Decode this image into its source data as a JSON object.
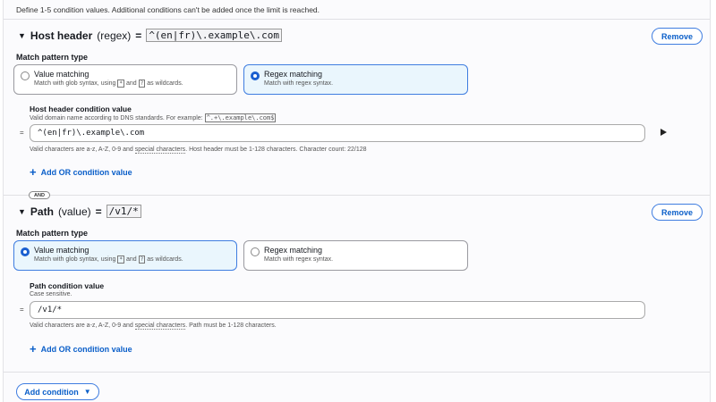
{
  "description": "Define 1-5 condition values. Additional conditions can't be added once the limit is reached.",
  "conditions": [
    {
      "title": "Host header",
      "mode": "(regex)",
      "equals": "=",
      "summary_value": "^(en|fr)\\.example\\.com",
      "remove_label": "Remove",
      "match_pattern_label": "Match pattern type",
      "options": [
        {
          "title": "Value matching",
          "sub_prefix": "Match with glob syntax, using",
          "wild1": "*",
          "and": "and",
          "wild2": "?",
          "sub_suffix": "as wildcards.",
          "selected": false
        },
        {
          "title": "Regex matching",
          "sub": "Match with regex syntax.",
          "selected": true
        }
      ],
      "value_label": "Host header condition value",
      "hint_prefix": "Valid domain name according to DNS standards. For example:",
      "hint_code": "^.+\\.example\\.com$",
      "input_value": "^(en|fr)\\.example\\.com",
      "help_prefix": "Valid characters are a-z, A-Z, 0-9 and",
      "help_link": "special characters",
      "help_suffix": ". Host header must be 1-128 characters. Character count: 22/128",
      "add_or_label": "Add OR condition value"
    },
    {
      "title": "Path",
      "mode": "(value)",
      "equals": "=",
      "summary_value": "/v1/*",
      "remove_label": "Remove",
      "match_pattern_label": "Match pattern type",
      "options": [
        {
          "title": "Value matching",
          "sub_prefix": "Match with glob syntax, using",
          "wild1": "*",
          "and": "and",
          "wild2": "?",
          "sub_suffix": "as wildcards.",
          "selected": true
        },
        {
          "title": "Regex matching",
          "sub": "Match with regex syntax.",
          "selected": false
        }
      ],
      "value_label": "Path condition value",
      "hint": "Case sensitive.",
      "input_value": "/v1/*",
      "help_prefix": "Valid characters are a-z, A-Z, 0-9 and",
      "help_link": "special characters",
      "help_suffix": ". Path must be 1-128 characters.",
      "add_or_label": "Add OR condition value"
    }
  ],
  "and_badge": "AND",
  "input_prefix": "=",
  "add_condition_label": "Add condition"
}
